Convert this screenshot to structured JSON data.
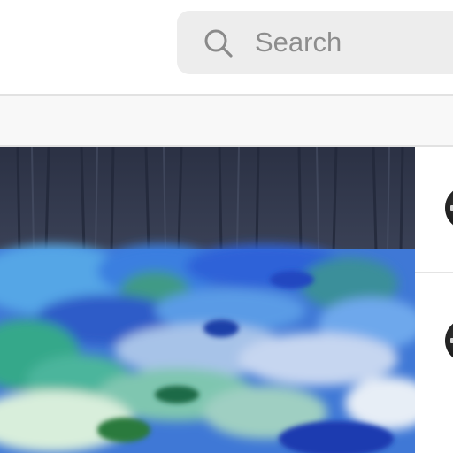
{
  "search": {
    "placeholder": "Search",
    "value": ""
  },
  "icons": {
    "search": "search-icon",
    "avatar": "avatar"
  },
  "colors": {
    "search_bg": "#ededed",
    "placeholder": "#8d8d8d",
    "subbar_bg": "#f8f8f8",
    "divider": "#e2e2e2"
  },
  "side_list": {
    "items": [
      {
        "avatar": "avatar"
      },
      {
        "avatar": "avatar"
      }
    ]
  }
}
